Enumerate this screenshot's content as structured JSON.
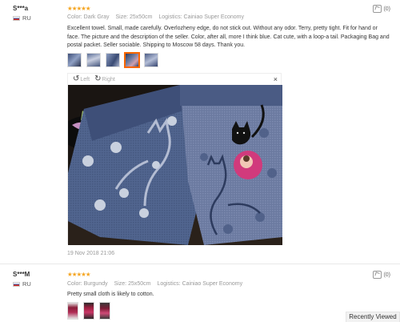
{
  "reviews": [
    {
      "user": "S***a",
      "country": "RU",
      "stars": "★★★★★",
      "color_label": "Color:",
      "color_value": "Dark Gray",
      "size_label": "Size:",
      "size_value": "25x50cm",
      "logistics_label": "Logistics:",
      "logistics_value": "Cainiao Super Economy",
      "helpful_count": "(0)",
      "text": "Excellent towel. Small, made carefully. Overlozheny edge, do not stick out. Without any odor. Terry, pretty tight. Fit for hand or face. The picture and the description of the seller. Color, after all, more I think blue. Cat cute, with a loop-a tail. Packaging Bag and postal packet. Seller sociable. Shipping to Moscow 58 days. Thank you.",
      "viewer": {
        "left_label": "Left",
        "right_label": "Right",
        "close": "×"
      },
      "date": "19 Nov 2018 21:06"
    },
    {
      "user": "S***M",
      "country": "RU",
      "stars": "★★★★★",
      "color_label": "Color:",
      "color_value": "Burgundy",
      "size_label": "Size:",
      "size_value": "25x50cm",
      "logistics_label": "Logistics:",
      "logistics_value": "Cainiao Super Economy",
      "helpful_count": "(0)",
      "text": "Pretty small cloth is likely to cotton."
    }
  ],
  "recently_viewed": "Recently Viewed",
  "colors": {
    "accent": "#f60",
    "star": "#f5a623",
    "towel": "#4a5f8a"
  }
}
